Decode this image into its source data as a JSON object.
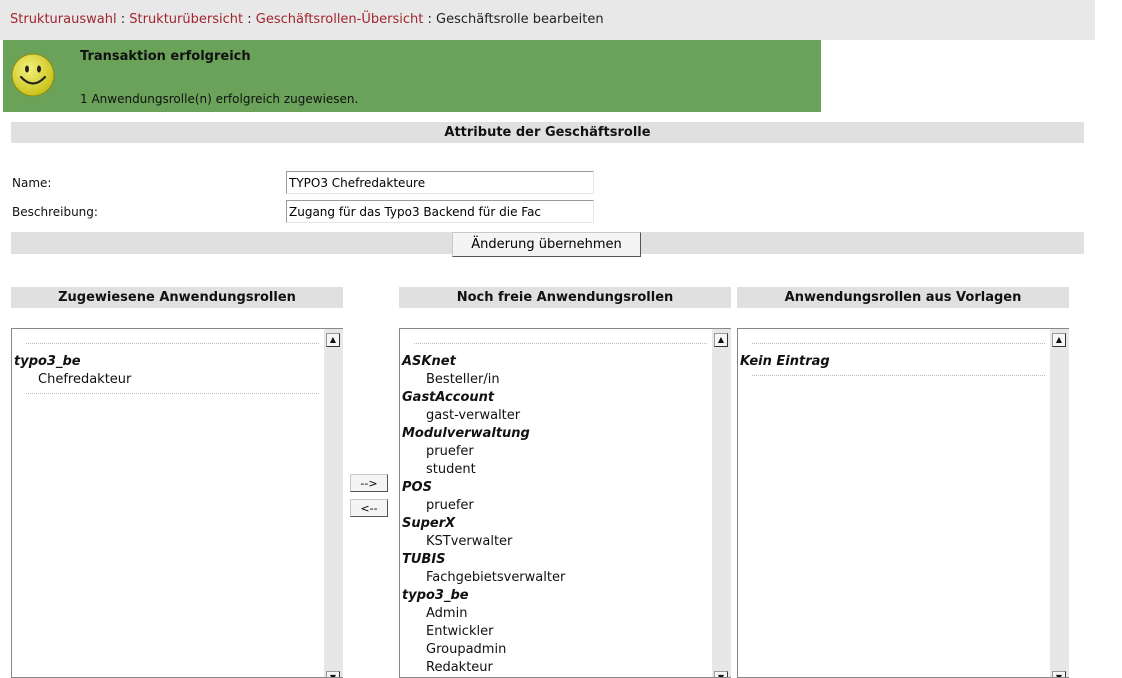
{
  "breadcrumb": {
    "links": [
      "Strukturauswahl",
      "Strukturübersicht",
      "Geschäftsrollen-Übersicht"
    ],
    "separator": ":",
    "current": "Geschäftsrolle bearbeiten"
  },
  "message": {
    "title": "Transaktion erfolgreich",
    "text": "1 Anwendungsrolle(n) erfolgreich zugewiesen.",
    "color": "#6aa25a"
  },
  "attributes": {
    "header": "Attribute der Geschäftsrolle",
    "name_label": "Name:",
    "name_value": "TYPO3 Chefredakteure",
    "desc_label": "Beschreibung:",
    "desc_value": "Zugang für das Typo3 Backend für die Fac",
    "apply_button": "Änderung übernehmen"
  },
  "assigned": {
    "header": "Zugewiesene Anwendungsrollen",
    "groups": [
      {
        "name": "typo3_be",
        "items": [
          "Chefredakteur"
        ]
      }
    ]
  },
  "move": {
    "add": "-->",
    "remove": "<--"
  },
  "free": {
    "header": "Noch freie Anwendungsrollen",
    "groups": [
      {
        "name": "ASKnet",
        "items": [
          "Besteller/in"
        ]
      },
      {
        "name": "GastAccount",
        "items": [
          "gast-verwalter"
        ]
      },
      {
        "name": "Modulverwaltung",
        "items": [
          "pruefer",
          "student"
        ]
      },
      {
        "name": "POS",
        "items": [
          "pruefer"
        ]
      },
      {
        "name": "SuperX",
        "items": [
          "KSTverwalter"
        ]
      },
      {
        "name": "TUBIS",
        "items": [
          "Fachgebietsverwalter"
        ]
      },
      {
        "name": "typo3_be",
        "items": [
          "Admin",
          "Entwickler",
          "Groupadmin",
          "Redakteur"
        ]
      }
    ]
  },
  "templates": {
    "header": "Anwendungsrollen aus Vorlagen",
    "empty": "Kein Eintrag"
  },
  "icons": {
    "scroll_up": "scroll-up-arrow-icon",
    "scroll_down": "scroll-down-arrow-icon",
    "smiley": "smiley-icon"
  }
}
